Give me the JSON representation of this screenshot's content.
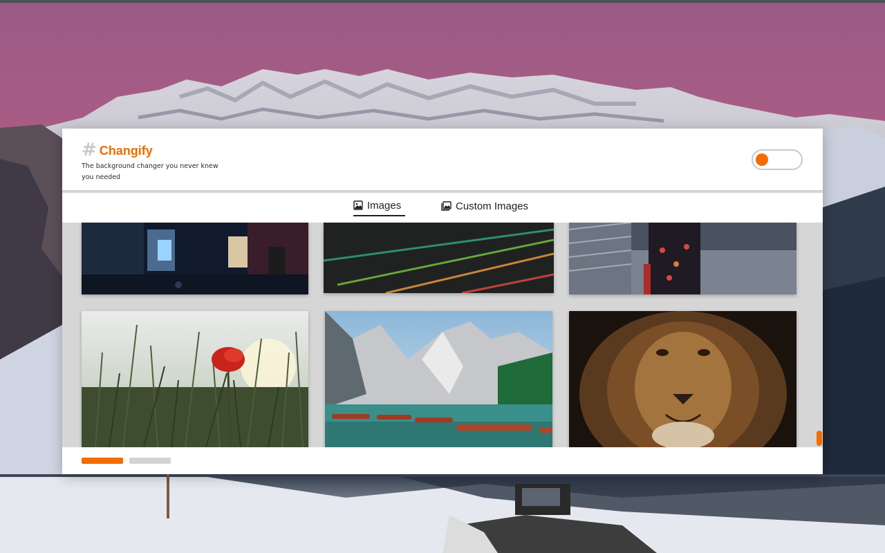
{
  "app": {
    "name": "Changify",
    "hash_symbol": "#",
    "tagline": "The background changer you never knew you needed"
  },
  "theme": {
    "accent": "#f26c00",
    "toggle_on": false
  },
  "tabs": [
    {
      "label": "Images",
      "icon": "image-icon",
      "active": true
    },
    {
      "label": "Custom Images",
      "icon": "image-stack-icon",
      "active": false
    }
  ],
  "gallery": {
    "thumbnails": [
      {
        "subject": "neon-alley"
      },
      {
        "subject": "light-streaks"
      },
      {
        "subject": "figure-in-rain"
      },
      {
        "subject": "red-poppy-field"
      },
      {
        "subject": "mountain-lake-boats"
      },
      {
        "subject": "lion-portrait"
      }
    ]
  },
  "pagination": {
    "pages": 2,
    "current": 1
  }
}
